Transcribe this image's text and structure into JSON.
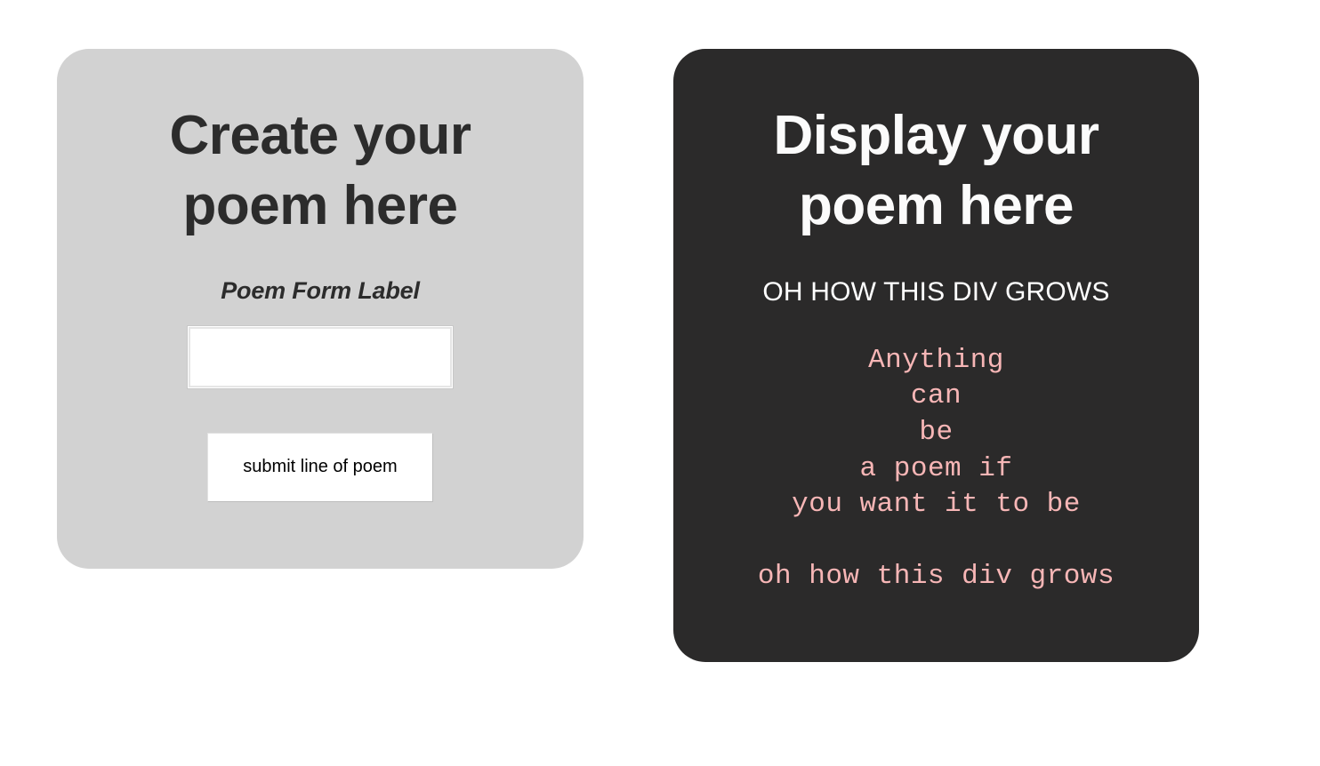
{
  "colors": {
    "page_background": "#ffffff",
    "create_panel_background": "#d2d2d2",
    "display_panel_background": "#2b2a2a",
    "heading_dark": "#2c2c2c",
    "heading_light": "#fbfbfb",
    "poem_text": "#f7b6b6",
    "input_background": "#ffffff",
    "button_background": "#ffffff"
  },
  "create_panel": {
    "heading": "Create your poem here",
    "form": {
      "label": "Poem Form Label",
      "input_value": "",
      "input_placeholder": "",
      "submit_label": "submit line of poem"
    }
  },
  "display_panel": {
    "heading": "Display your poem here",
    "subtitle": "OH HOW THIS DIV GROWS",
    "poem_lines": [
      "Anything",
      "can",
      "be",
      "a poem if",
      "you want it to be"
    ],
    "poem_footer_lines": [
      "oh how this div grows"
    ]
  }
}
